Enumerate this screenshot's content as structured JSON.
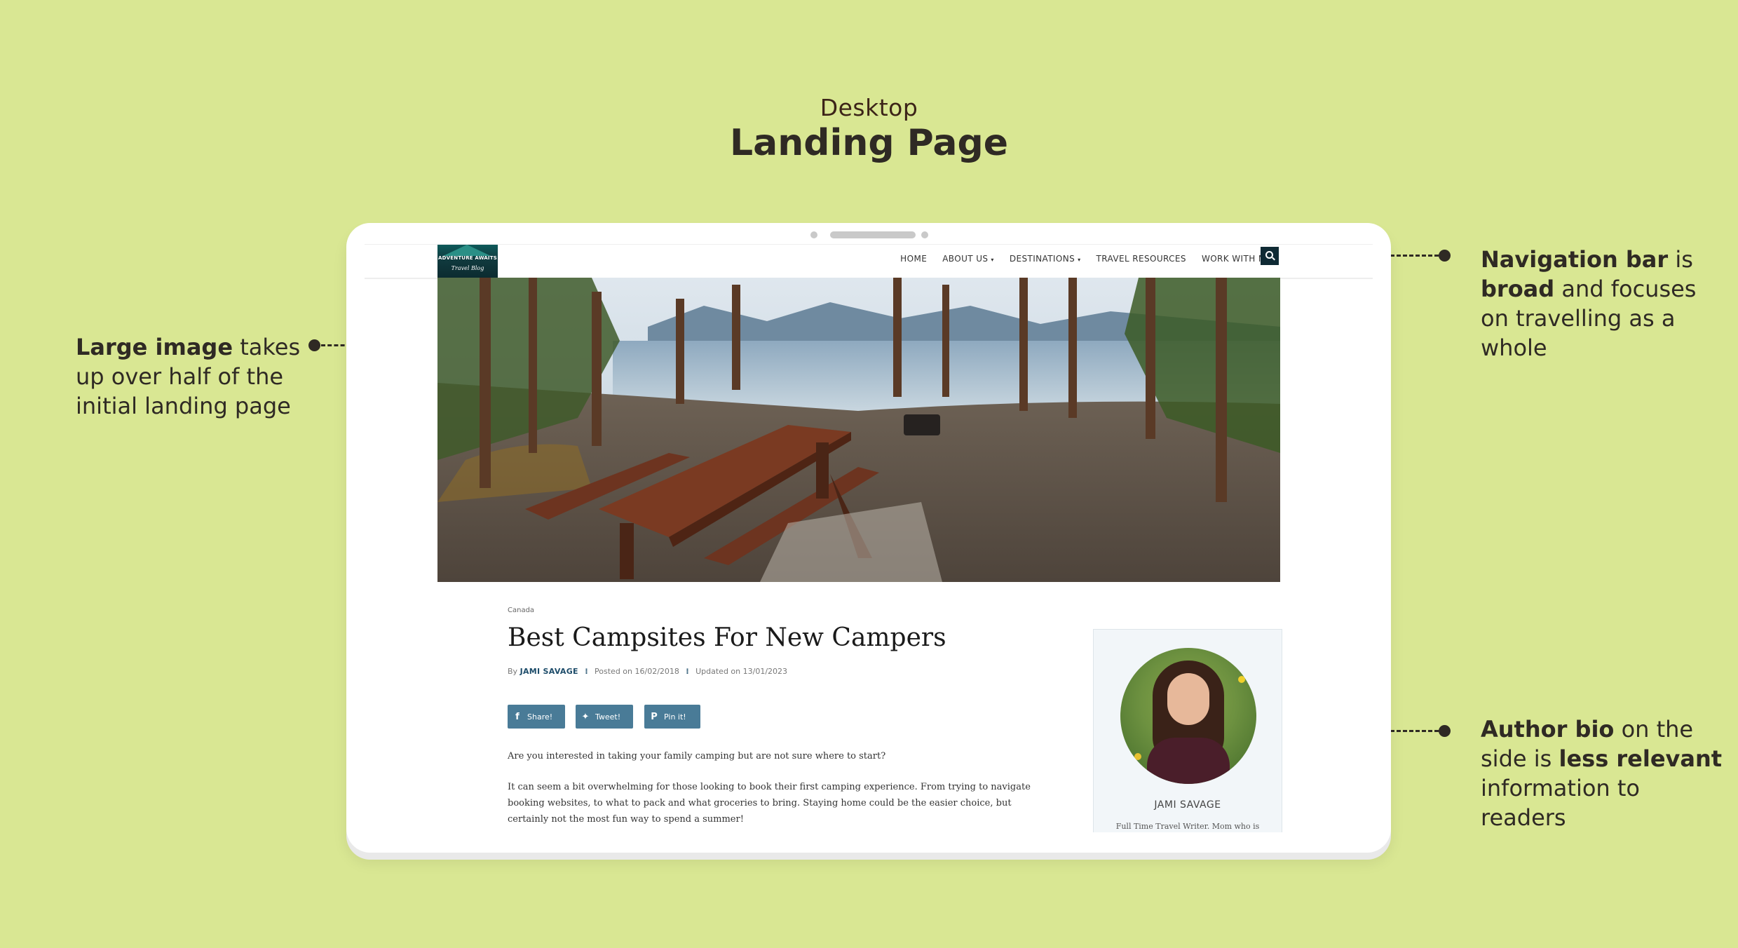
{
  "header": {
    "subtitle": "Desktop",
    "title": "Landing Page"
  },
  "notes": {
    "left": {
      "bold": "Large image",
      "rest1": " takes",
      "line2": "up over half of the",
      "line3": "initial landing page"
    },
    "nav": {
      "b1": "Navigation bar",
      "t1": " is",
      "b2": "broad",
      "t2": " and focuses",
      "line3": "on travelling as a",
      "line4": "whole"
    },
    "bio": {
      "b1": "Author bio",
      "t1": " on the",
      "t2": "side is ",
      "b2": "less relevant",
      "line3": "information to",
      "line4": "readers"
    }
  },
  "site": {
    "logo": {
      "line1": "ADVENTURE AWAITS",
      "line2": "Travel Blog"
    },
    "nav": [
      {
        "label": "HOME",
        "has_dropdown": false
      },
      {
        "label": "ABOUT US",
        "has_dropdown": true
      },
      {
        "label": "DESTINATIONS",
        "has_dropdown": true
      },
      {
        "label": "TRAVEL RESOURCES",
        "has_dropdown": false
      },
      {
        "label": "WORK WITH ME",
        "has_dropdown": true
      }
    ],
    "search_icon": "search-icon",
    "dropdown_icon": "chevron-down-icon",
    "accent": "#0f2a34"
  },
  "article": {
    "category": "Canada",
    "title": "Best Campsites For New Campers",
    "by": "By",
    "author": "JAMI SAVAGE",
    "posted": "Posted on 16/02/2018",
    "updated": "Updated on 13/01/2023",
    "share_buttons": [
      {
        "icon": "facebook-icon",
        "glyph": "f",
        "label": "Share!"
      },
      {
        "icon": "twitter-icon",
        "glyph": "✦",
        "label": "Tweet!"
      },
      {
        "icon": "pinterest-icon",
        "glyph": "P",
        "label": "Pin it!"
      }
    ],
    "paragraphs": [
      "Are you interested in taking your family camping but are not sure where to start?",
      "It can seem a bit overwhelming for those looking to book their first camping experience. From trying to navigate booking websites, to what to pack and what groceries to bring. Staying home could be the easier choice, but certainly not the most fun way to spend a summer!"
    ],
    "share_color": "#497b97"
  },
  "author_card": {
    "name": "JAMI SAVAGE",
    "description": "Full Time Travel Writer. Mom who is"
  }
}
